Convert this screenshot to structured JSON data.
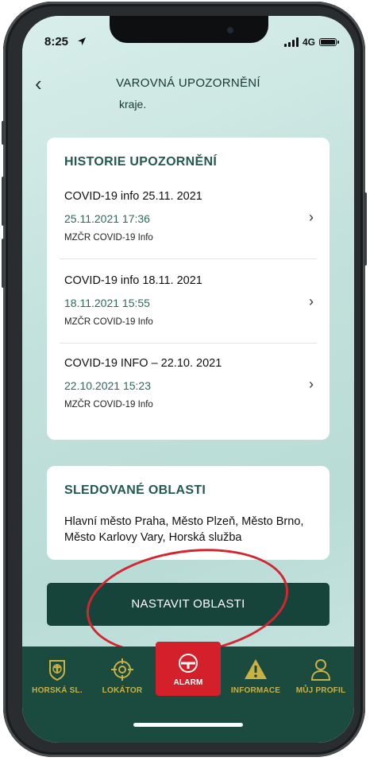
{
  "status": {
    "time": "8:25",
    "network": "4G"
  },
  "header": {
    "title": "VAROVNÁ UPOZORNĚNÍ",
    "subtitle": "kraje."
  },
  "history": {
    "heading": "HISTORIE UPOZORNĚNÍ",
    "items": [
      {
        "title": "COVID-19 info 25.11. 2021",
        "date": "25.11.2021 17:36",
        "source": "MZČR COVID-19 Info"
      },
      {
        "title": "COVID-19 info 18.11. 2021",
        "date": "18.11.2021 15:55",
        "source": "MZČR COVID-19 Info"
      },
      {
        "title": "COVID-19 INFO – 22.10. 2021",
        "date": "22.10.2021 15:23",
        "source": "MZČR COVID-19 Info"
      }
    ]
  },
  "areas": {
    "heading": "SLEDOVANÉ OBLASTI",
    "text": "Hlavní město Praha, Město Plzeň, Město Brno, Město Karlovy Vary, Horská služba"
  },
  "button": {
    "label": "NASTAVIT OBLASTI"
  },
  "tabs": [
    {
      "label": "HORSKÁ SL.",
      "icon": "badge-icon"
    },
    {
      "label": "LOKÁTOR",
      "icon": "crosshair-icon"
    },
    {
      "label": "ALARM",
      "icon": "alarm-icon",
      "active": true
    },
    {
      "label": "INFORMACE",
      "icon": "warning-icon"
    },
    {
      "label": "MŮJ PROFIL",
      "icon": "profile-icon"
    }
  ],
  "colors": {
    "accent": "#17443a",
    "heading": "#245a4d",
    "alarm": "#d4202a",
    "tab_label": "#c9b143"
  }
}
